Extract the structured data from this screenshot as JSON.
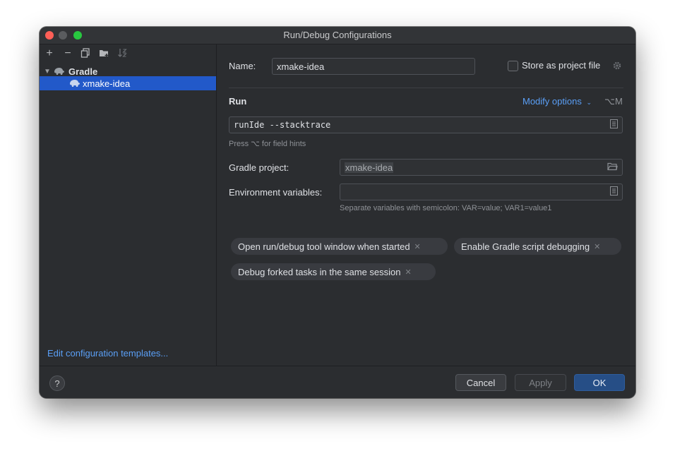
{
  "window": {
    "title": "Run/Debug Configurations"
  },
  "sidebar": {
    "toolbar": {
      "add": "+",
      "remove": "−"
    },
    "group": "Gradle",
    "item": "xmake-idea",
    "edit_templates": "Edit configuration templates..."
  },
  "form": {
    "name_label": "Name:",
    "name_value": "xmake-idea",
    "store_label": "Store as project file",
    "run_section": "Run",
    "modify_options": "Modify options",
    "modify_shortcut": "⌥M",
    "run_value": "runIde --stacktrace",
    "run_hint": "Press ⌥ for field hints",
    "gradle_project_label": "Gradle project:",
    "gradle_project_value": "xmake-idea",
    "env_label": "Environment variables:",
    "env_value": "",
    "env_hint": "Separate variables with semicolon: VAR=value; VAR1=value1"
  },
  "chips": [
    "Open run/debug tool window when started",
    "Enable Gradle script debugging",
    "Debug forked tasks in the same session"
  ],
  "footer": {
    "help": "?",
    "cancel": "Cancel",
    "apply": "Apply",
    "ok": "OK"
  },
  "colors": {
    "selection": "#2259c9",
    "link": "#5a9ff6",
    "ok_button": "#264e86"
  }
}
